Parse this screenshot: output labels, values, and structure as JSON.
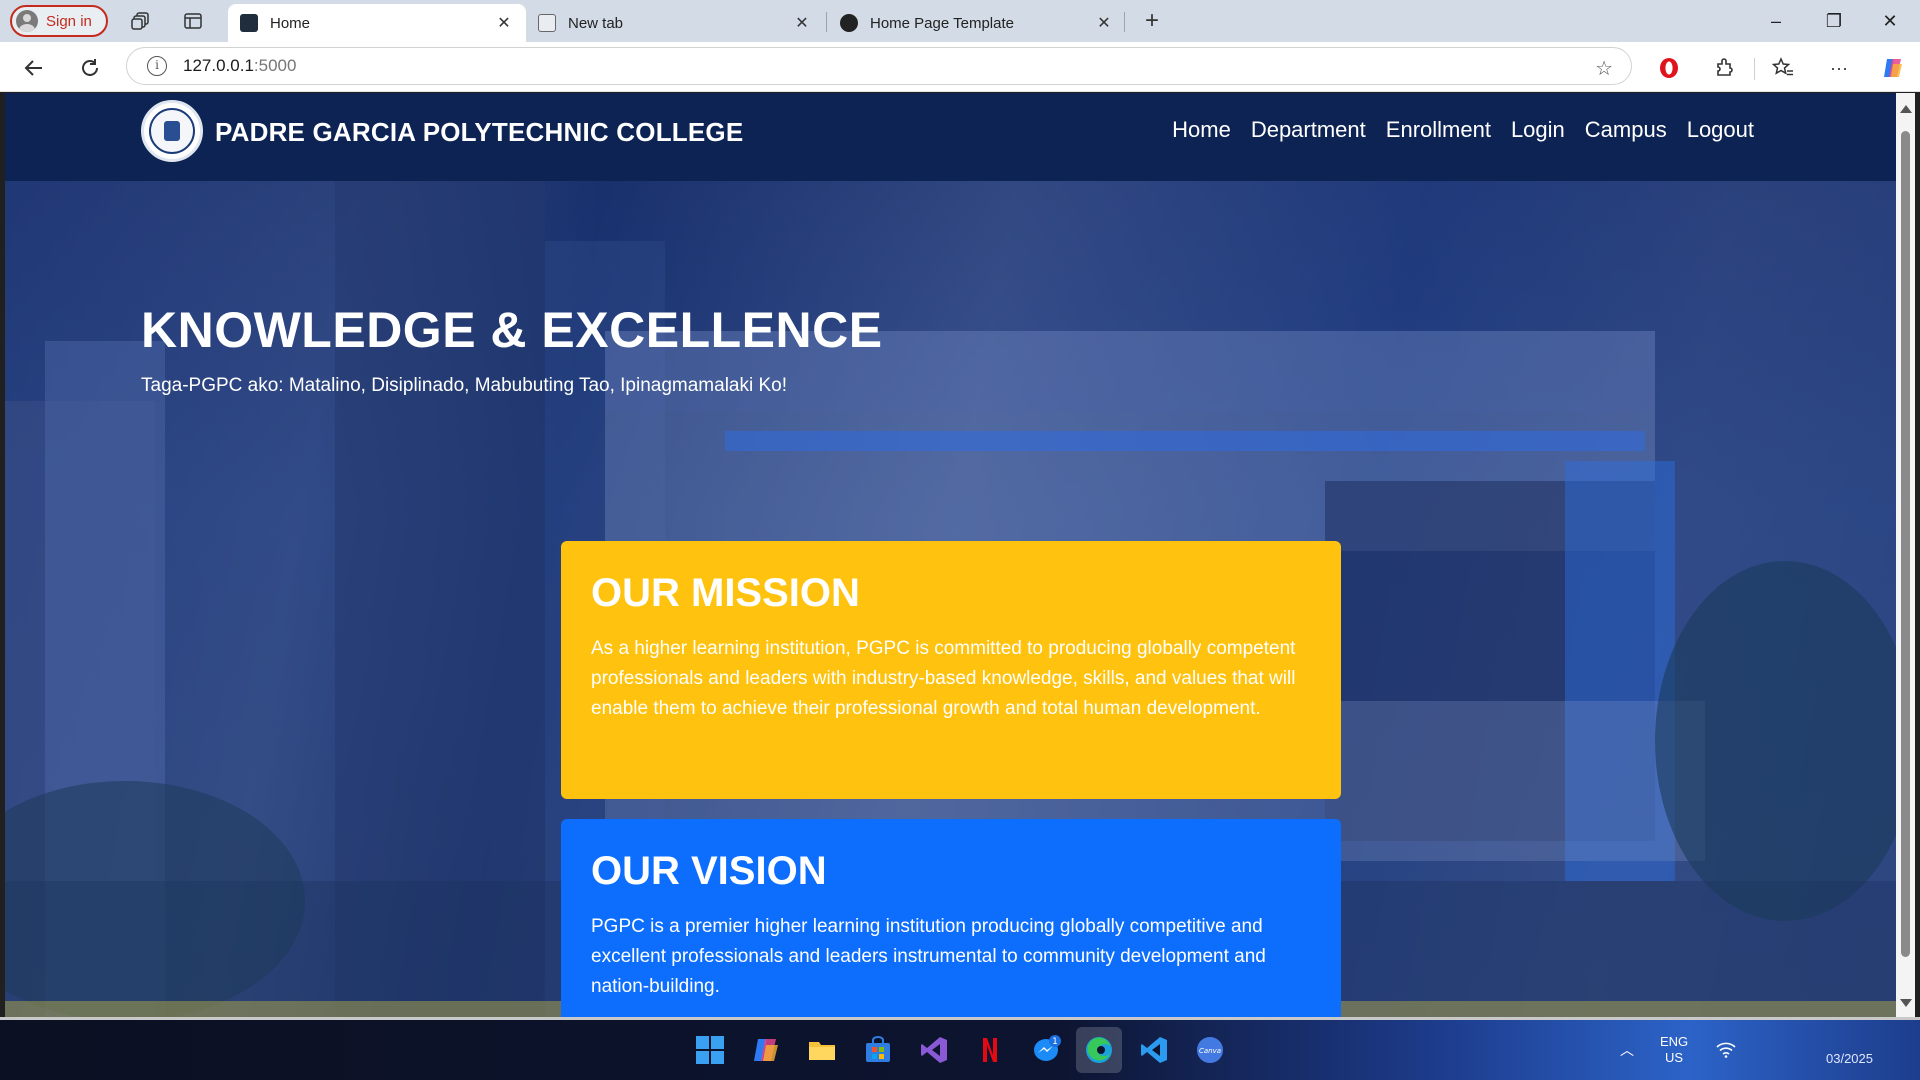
{
  "browser": {
    "signin_label": "Sign in",
    "tabs": [
      {
        "title": "Home",
        "active": true
      },
      {
        "title": "New tab",
        "active": false
      },
      {
        "title": "Home Page Template",
        "active": false
      }
    ],
    "url_host": "127.0.0.1",
    "url_port": ":5000",
    "icons": [
      "workspaces-icon",
      "tab-actions-icon",
      "back-icon",
      "refresh-icon",
      "info-icon",
      "favorite-star-icon",
      "opera-icon",
      "extensions-icon",
      "favorites-icon",
      "more-icon",
      "copilot-icon"
    ]
  },
  "site": {
    "brand": "PADRE GARCIA POLYTECHNIC COLLEGE",
    "menu": [
      "Home",
      "Department",
      "Enrollment",
      "Login",
      "Campus",
      "Logout"
    ],
    "hero_title": "KNOWLEDGE & EXCELLENCE",
    "hero_subtitle": "Taga-PGPC ako: Matalino, Disiplinado, Mabubuting Tao, Ipinagmamalaki Ko!",
    "mission": {
      "title": "OUR MISSION",
      "text": "As a higher learning institution, PGPC is committed to producing globally competent professionals and leaders with industry-based knowledge, skills, and values that will enable them to achieve their professional growth and total human development."
    },
    "vision": {
      "title": "OUR VISION",
      "text": "PGPC is a premier higher learning institution producing globally competitive and excellent professionals and leaders instrumental to community development and nation-building."
    },
    "colors": {
      "navbar": "#0d2354",
      "mission": "#ffc20e",
      "vision": "#0d6efd"
    }
  },
  "taskbar": {
    "apps": [
      "windows-start-icon",
      "copilot-app-icon",
      "file-explorer-icon",
      "microsoft-store-icon",
      "visual-studio-icon",
      "netflix-icon",
      "messenger-icon",
      "edge-icon",
      "vscode-icon",
      "canva-icon"
    ],
    "messenger_badge": "1",
    "language": "ENG",
    "region": "US",
    "date_partial": "03/2025"
  }
}
